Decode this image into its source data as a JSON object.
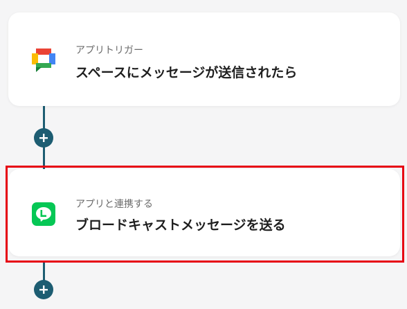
{
  "steps": [
    {
      "kicker": "アプリトリガー",
      "title": "スペースにメッセージが送信されたら",
      "icon": "google-chat-icon"
    },
    {
      "kicker": "アプリと連携する",
      "title": "ブロードキャストメッセージを送る",
      "icon": "line-icon",
      "highlighted": true
    }
  ],
  "colors": {
    "connector": "#1d5d72",
    "highlight": "#e60012",
    "line_brand": "#06c755"
  }
}
